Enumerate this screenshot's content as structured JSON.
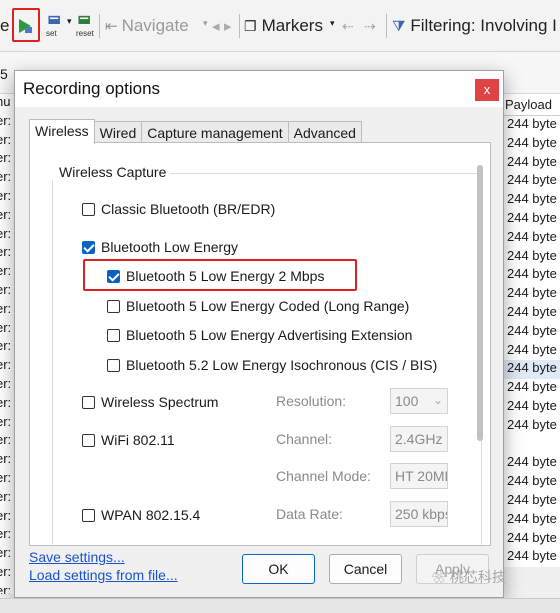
{
  "toolbar": {
    "navigate_label": "Navigate",
    "markers_label": "Markers",
    "filtering_label": "Filtering: Involving I",
    "set_label": "set",
    "reset_label": "reset",
    "partial_left": "e"
  },
  "background": {
    "partial_top_label": "5",
    "payload_header": "Payload",
    "row_value": "244 byte",
    "left_partial": "er:",
    "left_header_partial": "nu"
  },
  "dialog": {
    "title": "Recording options",
    "close_label": "x",
    "tabs": [
      {
        "label": "Wireless",
        "active": true
      },
      {
        "label": "Wired",
        "active": false
      },
      {
        "label": "Capture management",
        "active": false
      },
      {
        "label": "Advanced",
        "active": false
      }
    ],
    "group_title": "Wireless Capture",
    "options": {
      "classic_bt": {
        "label": "Classic Bluetooth (BR/EDR)",
        "checked": false
      },
      "ble": {
        "label": "Bluetooth Low Energy",
        "checked": true
      },
      "ble_2m": {
        "label": "Bluetooth 5 Low Energy 2 Mbps",
        "checked": true
      },
      "ble_coded": {
        "label": "Bluetooth 5 Low Energy Coded (Long Range)",
        "checked": false
      },
      "ble_adv_ext": {
        "label": "Bluetooth 5 Low Energy Advertising Extension",
        "checked": false
      },
      "ble_iso": {
        "label": "Bluetooth 5.2 Low Energy Isochronous (CIS / BIS)",
        "checked": false
      },
      "spectrum": {
        "label": "Wireless Spectrum",
        "checked": false
      },
      "wifi": {
        "label": "WiFi 802.11",
        "checked": false
      },
      "wpan": {
        "label": "WPAN 802.15.4",
        "checked": false
      }
    },
    "fields": {
      "resolution_label": "Resolution:",
      "resolution_value": "100",
      "channel_label": "Channel:",
      "channel_value": "2.4GHz c",
      "channel_mode_label": "Channel Mode:",
      "channel_mode_value": "HT 20MH",
      "data_rate_label": "Data Rate:",
      "data_rate_value": "250 kbps"
    },
    "links": {
      "save": "Save settings...",
      "load": "Load settings from file..."
    },
    "buttons": {
      "ok": "OK",
      "cancel": "Cancel",
      "apply": "Apply"
    }
  },
  "watermark": "桃芯科技",
  "colors": {
    "accent": "#0a62c4",
    "highlight": "#e02020",
    "close": "#e04343",
    "link": "#1a53c9"
  }
}
